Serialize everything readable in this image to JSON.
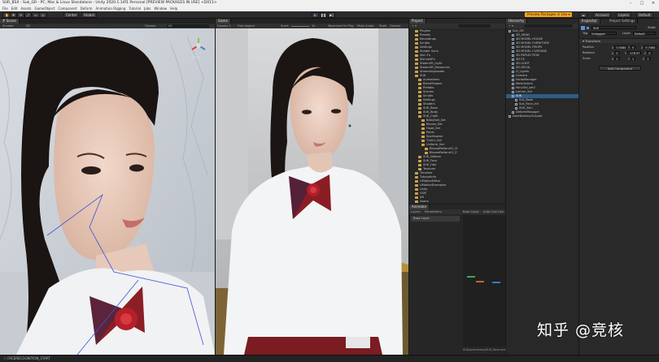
{
  "window": {
    "title": "SUR_BSX - Suk_GR - PC, Mac & Linux Standalone - Unity 2020.1.14f1 Personal [PREVIEW PACKAGES IN USE] <DX11>"
  },
  "menu": [
    "File",
    "Edit",
    "Assets",
    "GameObject",
    "Component",
    "Deform",
    "Animation Rigging",
    "Tutorial",
    "Jobs",
    "Window",
    "Help"
  ],
  "toolbar": {
    "pivot": "Center",
    "space": "Global",
    "preview_packages": "Preview Packages in Use ▾",
    "account": "Account",
    "layers": "Layers",
    "layout": "Default"
  },
  "scene": {
    "tab": "# Scene",
    "shading": "Shaded",
    "mode": "2D",
    "gizmos": "Gizmos",
    "search": "All",
    "persp": "Persp"
  },
  "game": {
    "tab": "Game",
    "display": "Display 1",
    "aspect": "Free Aspect",
    "scale_label": "Scale",
    "scale_value": "1x",
    "maximize": "Maximize On Play",
    "mute": "Mute Audio",
    "stats": "Stats",
    "gizmos": "Gizmos"
  },
  "project": {
    "tab": "Project",
    "items": [
      {
        "label": "Plugins",
        "depth": 1
      },
      {
        "label": "Presets",
        "depth": 1
      },
      {
        "label": "Recordings",
        "depth": 1
      },
      {
        "label": "Scripts",
        "depth": 1
      },
      {
        "label": "Settings",
        "depth": 1
      },
      {
        "label": "Shader Suns",
        "depth": 1
      },
      {
        "label": "Skin Fx",
        "depth": 1
      },
      {
        "label": "SkinnedFx",
        "depth": 1
      },
      {
        "label": "SteamVR_Light",
        "depth": 1
      },
      {
        "label": "SteamVR_Resources",
        "depth": 1
      },
      {
        "label": "StreamingAssets",
        "depth": 1
      },
      {
        "label": "SUK",
        "depth": 1
      },
      {
        "label": "Animations",
        "depth": 2
      },
      {
        "label": "BlendShapes",
        "depth": 2
      },
      {
        "label": "Prefabs",
        "depth": 2
      },
      {
        "label": "Scenes",
        "depth": 2
      },
      {
        "label": "Scripts",
        "depth": 2
      },
      {
        "label": "Settings",
        "depth": 2
      },
      {
        "label": "Shaders",
        "depth": 2
      },
      {
        "label": "SUK_Base",
        "depth": 2
      },
      {
        "label": "SUK_Body",
        "depth": 2
      },
      {
        "label": "SUK_Cloth",
        "depth": 2
      },
      {
        "label": "BabyDoll_Set",
        "depth": 3
      },
      {
        "label": "Blouse_Set",
        "depth": 3
      },
      {
        "label": "Hood_Set",
        "depth": 3
      },
      {
        "label": "Pants",
        "depth": 3
      },
      {
        "label": "Sportswear",
        "depth": 3
      },
      {
        "label": "T-shirt_Set",
        "depth": 3
      },
      {
        "label": "Uniform_Set",
        "depth": 3
      },
      {
        "label": "BlousePattern01_D",
        "depth": 4
      },
      {
        "label": "BlousePattern01_E",
        "depth": 4
      },
      {
        "label": "SUK_Deform",
        "depth": 2
      },
      {
        "label": "SUK_Face",
        "depth": 2
      },
      {
        "label": "SUK_Hair",
        "depth": 2
      },
      {
        "label": "Textures",
        "depth": 2
      },
      {
        "label": "Timeline",
        "depth": 1
      },
      {
        "label": "TutorialInfo",
        "depth": 1
      },
      {
        "label": "UMotionEditor",
        "depth": 1
      },
      {
        "label": "UMotionExamples",
        "depth": 1
      },
      {
        "label": "Unity",
        "depth": 1
      },
      {
        "label": "VIVE",
        "depth": 1
      },
      {
        "label": "XR",
        "depth": 1
      },
      {
        "label": "Xsens",
        "depth": 1
      },
      {
        "label": "Actor_F_Animation",
        "depth": 1
      }
    ]
  },
  "hierarchy": {
    "tab": "Hierarchy",
    "items": [
      {
        "label": "Suk_GR",
        "depth": 0
      },
      {
        "label": "3D_HEAD",
        "depth": 1
      },
      {
        "label": "3D MODEL HOUSE",
        "depth": 1
      },
      {
        "label": "3D MODEL FURNITURE",
        "depth": 1
      },
      {
        "label": "3D MODEL PROPS",
        "depth": 1
      },
      {
        "label": "3D MODEL CURTAINS",
        "depth": 1
      },
      {
        "label": "3D REFLECTION",
        "depth": 1
      },
      {
        "label": "3D FX",
        "depth": 1
      },
      {
        "label": "3D LIGHT",
        "depth": 1
      },
      {
        "label": "3D DECAL",
        "depth": 1
      },
      {
        "label": "Cl_Lights",
        "depth": 1
      },
      {
        "label": "Camera",
        "depth": 1
      },
      {
        "label": "FacialManager",
        "depth": 1
      },
      {
        "label": "MeshActors",
        "depth": 1
      },
      {
        "label": "PonyTail_set2",
        "depth": 1
      },
      {
        "label": "Lemiar_Set",
        "depth": 1
      },
      {
        "label": "SUK",
        "depth": 1
      },
      {
        "label": "Suk_Base",
        "depth": 2
      },
      {
        "label": "Suk_Face_ctrl",
        "depth": 2
      },
      {
        "label": "SUK_Skin",
        "depth": 2
      },
      {
        "label": "DeformManager",
        "depth": 1
      },
      {
        "label": "DontDestroyOnLoad",
        "depth": 0
      }
    ],
    "selected_index": 16
  },
  "inspector": {
    "tabs": [
      "Inspector",
      "Project Settings"
    ],
    "name": "SUK",
    "static": "Static",
    "tag_label": "Tag",
    "tag_value": "Untagged",
    "layer_label": "Layer",
    "layer_value": "Default",
    "component": "Transform",
    "position": {
      "label": "Position",
      "x": "0.5484",
      "y": "0",
      "z": "0.7484"
    },
    "rotation": {
      "label": "Rotation",
      "x": "0",
      "y": "-176.97",
      "z": "0"
    },
    "scale": {
      "label": "Scale",
      "x": "1",
      "y": "1",
      "z": "1"
    },
    "add_component": "Add Component"
  },
  "animator": {
    "tab": "Animator",
    "subtabs": [
      "Layers",
      "Parameters"
    ],
    "base_layer_crumb": "Base Layer",
    "auto_live": "Auto Live Link",
    "layer_item": "Base Layer",
    "footer": "SUK/animations/SUK_Face.contro"
  },
  "status": "FACERECOGNITION_START",
  "watermark": "知乎 @竞核"
}
